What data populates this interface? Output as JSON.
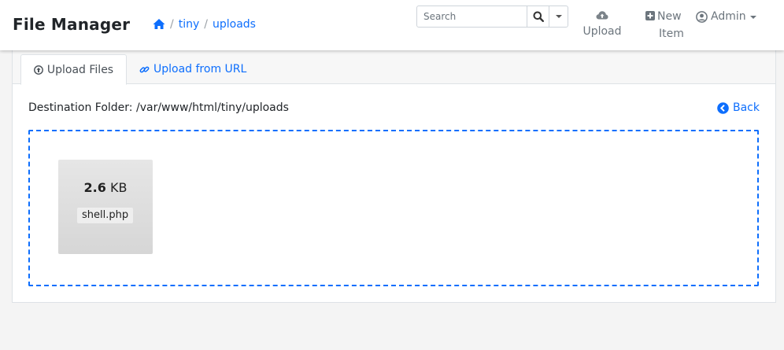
{
  "header": {
    "brand": "File Manager",
    "breadcrumb": {
      "home_icon": "home-icon",
      "separator": "/",
      "items": [
        "tiny",
        "uploads"
      ]
    },
    "search": {
      "placeholder": "Search",
      "value": ""
    },
    "upload": {
      "label": "Upload",
      "icon": "cloud-upload-icon"
    },
    "new_item": {
      "line1": "New",
      "line2": "Item",
      "icon": "plus-square-icon"
    },
    "user": {
      "label": "Admin",
      "icon": "user-circle-icon"
    }
  },
  "tabs": [
    {
      "label": "Upload Files",
      "icon": "arrow-circle-up-icon",
      "active": true
    },
    {
      "label": "Upload from URL",
      "icon": "link-icon",
      "active": false
    }
  ],
  "destination": {
    "label": "Destination Folder:",
    "path": "/var/www/html/tiny/uploads"
  },
  "back": {
    "label": "Back",
    "icon": "chevron-circle-left-icon"
  },
  "dropzone": {
    "files": [
      {
        "size_value": "2.6",
        "size_unit": "KB",
        "name": "shell.php"
      }
    ]
  },
  "colors": {
    "accent": "#0d6efd",
    "muted": "#6c757d",
    "page_bg": "#f4f4f4"
  }
}
